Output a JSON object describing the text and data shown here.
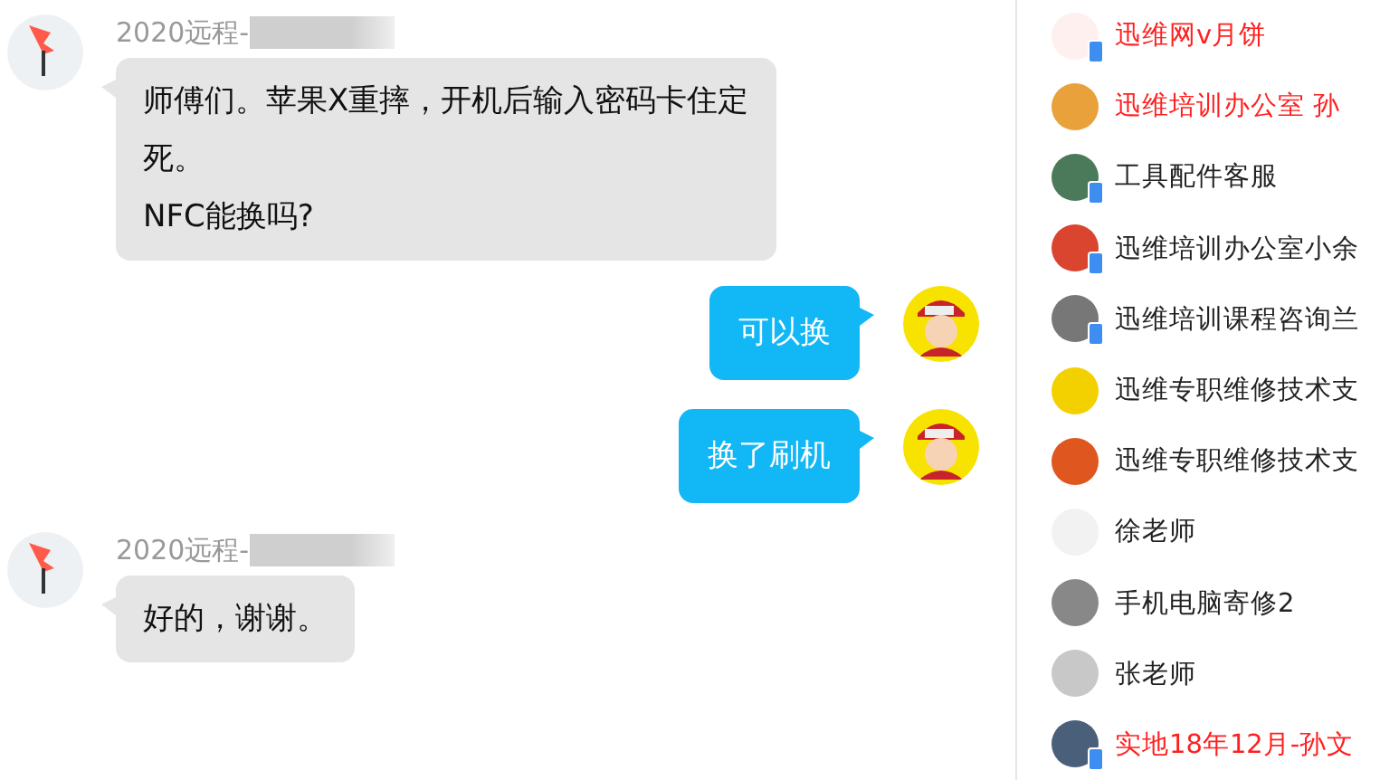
{
  "messages": [
    {
      "kind": "incoming",
      "sender": "2020远程-",
      "lines": [
        "师傅们。苹果X重摔，开机后输入密码卡住定",
        "死。",
        "NFC能换吗?"
      ]
    },
    {
      "kind": "outgoing",
      "lines": [
        "可以换"
      ]
    },
    {
      "kind": "outgoing",
      "lines": [
        "换了刷机"
      ]
    },
    {
      "kind": "incoming",
      "sender": "2020远程-",
      "lines": [
        "好的，谢谢。"
      ]
    }
  ],
  "contacts": [
    {
      "name": "迅维网v月饼",
      "color": "#ff2020",
      "mobile": true
    },
    {
      "name": "迅维培训办公室 孙",
      "color": "#ff2020",
      "mobile": false
    },
    {
      "name": "工具配件客服",
      "color": "#222222",
      "mobile": true
    },
    {
      "name": "迅维培训办公室小余",
      "color": "#222222",
      "mobile": true
    },
    {
      "name": "迅维培训课程咨询兰",
      "color": "#222222",
      "mobile": true
    },
    {
      "name": "迅维专职维修技术支",
      "color": "#222222",
      "mobile": false
    },
    {
      "name": "迅维专职维修技术支",
      "color": "#222222",
      "mobile": false
    },
    {
      "name": "徐老师",
      "color": "#222222",
      "mobile": false
    },
    {
      "name": "手机电脑寄修2",
      "color": "#222222",
      "mobile": false
    },
    {
      "name": "张老师",
      "color": "#222222",
      "mobile": false
    },
    {
      "name": "实地18年12月-孙文",
      "color": "#ff2020",
      "mobile": true
    }
  ]
}
